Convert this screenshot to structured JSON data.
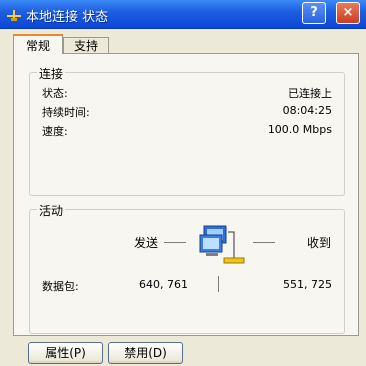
{
  "window": {
    "title": "本地连接 状态",
    "help_label": "?",
    "close_label": "×"
  },
  "tabs": [
    {
      "label": "常规"
    },
    {
      "label": "支持"
    }
  ],
  "connection": {
    "group_title": "连接",
    "rows": [
      {
        "label": "状态:",
        "value": "已连接上"
      },
      {
        "label": "持续时间:",
        "value": "08:04:25"
      },
      {
        "label": "速度:",
        "value": "100.0 Mbps"
      }
    ]
  },
  "activity": {
    "group_title": "活动",
    "sent_label": "发送",
    "received_label": "收到",
    "packets_label": "数据包:",
    "sent_packets": "640, 761",
    "received_packets": "551, 725"
  },
  "buttons": {
    "properties": "属性(P)",
    "disable": "禁用(D)"
  }
}
